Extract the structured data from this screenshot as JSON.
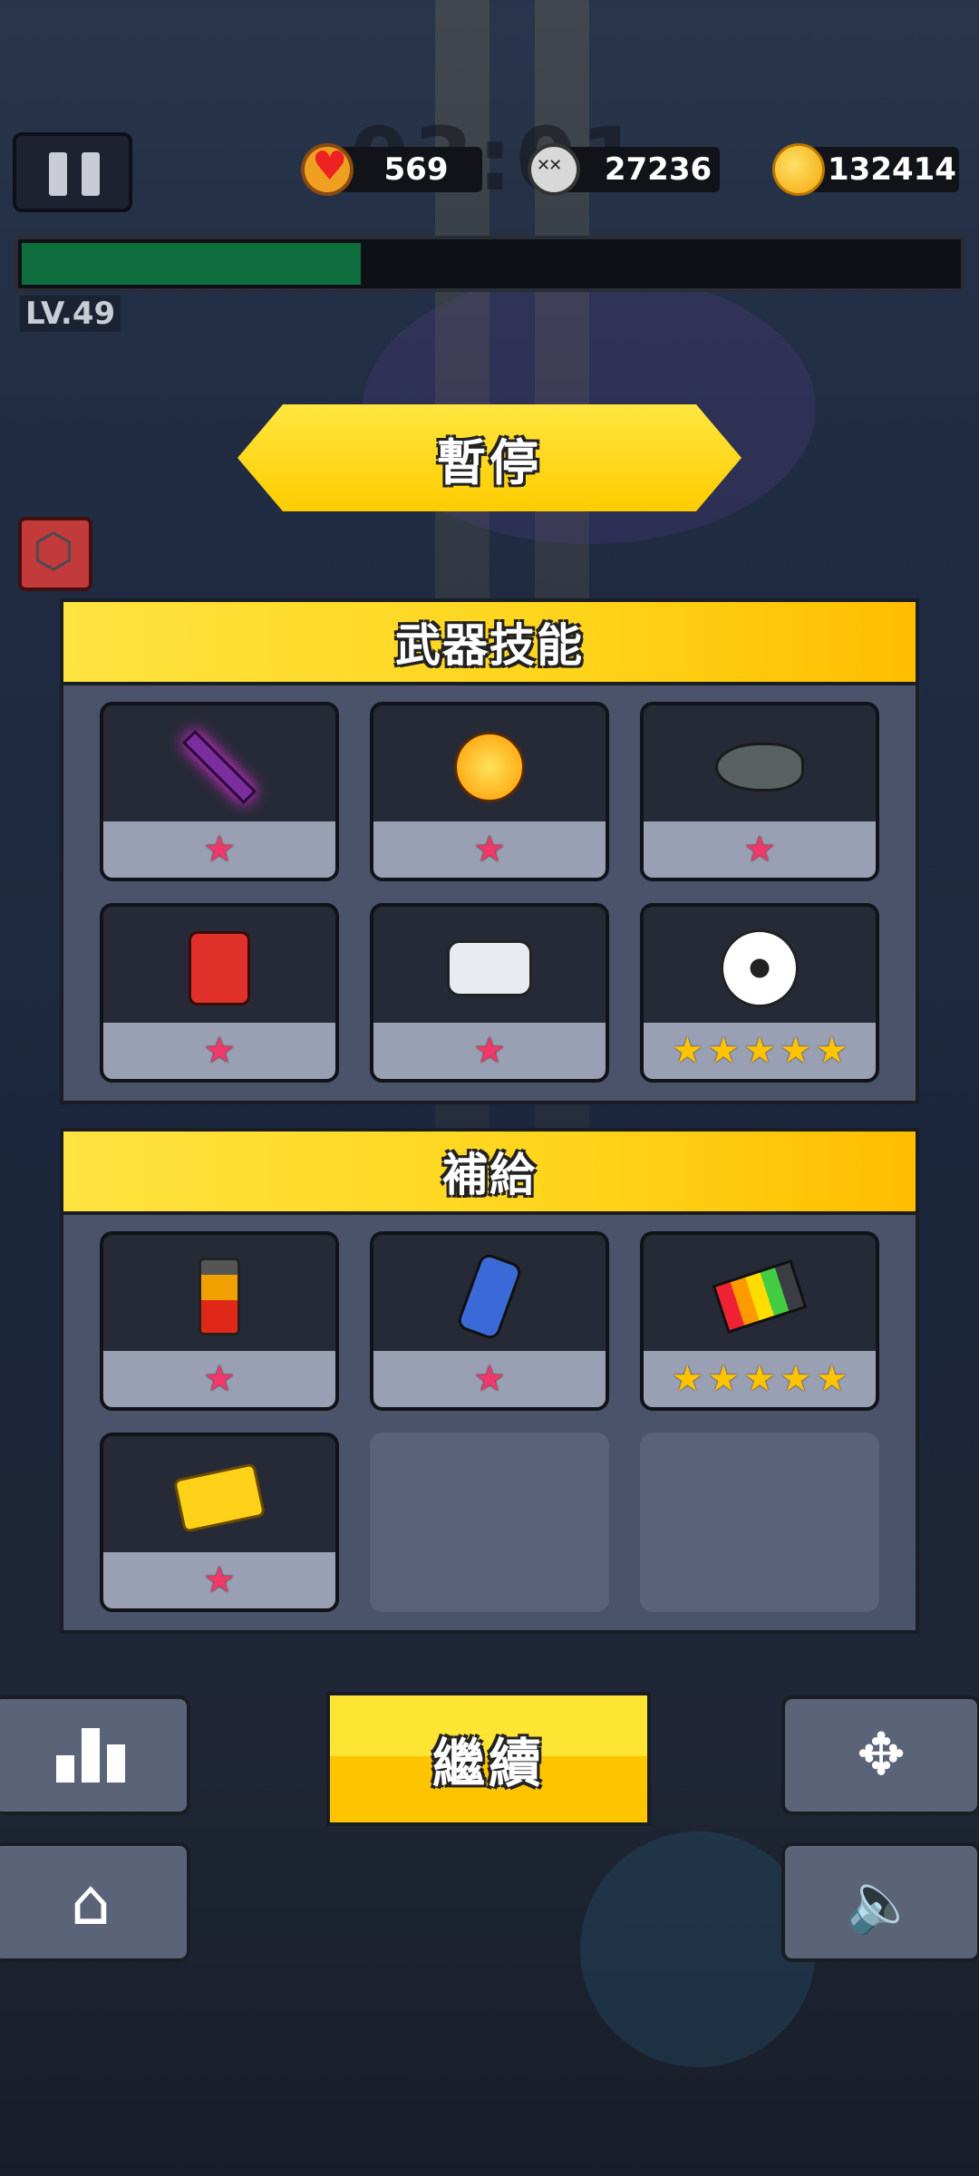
{
  "hud": {
    "hearts": "569",
    "kills": "27236",
    "coins": "132414",
    "level": "LV.49",
    "timer_ghost": "03:01",
    "xp_progress": 0.36
  },
  "pause_title": "暫停",
  "weapons": {
    "title": "武器技能",
    "slots": [
      {
        "icon": "sword-icon",
        "stars": 1,
        "star_color": "pink"
      },
      {
        "icon": "fireball-paw-icon",
        "stars": 1,
        "star_color": "pink"
      },
      {
        "icon": "shark-rocket-icon",
        "stars": 1,
        "star_color": "pink"
      },
      {
        "icon": "fuel-can-icon",
        "stars": 1,
        "star_color": "pink"
      },
      {
        "icon": "drone-icon",
        "stars": 1,
        "star_color": "pink"
      },
      {
        "icon": "soccer-ball-icon",
        "stars": 5,
        "star_color": "gold"
      }
    ]
  },
  "supplies": {
    "title": "補給",
    "slots": [
      {
        "icon": "battery-icon",
        "stars": 1,
        "star_color": "pink"
      },
      {
        "icon": "spray-can-icon",
        "stars": 1,
        "star_color": "pink"
      },
      {
        "icon": "charger-icon",
        "stars": 5,
        "star_color": "gold"
      },
      {
        "icon": "ticket-icon",
        "stars": 1,
        "star_color": "pink"
      }
    ],
    "empty_slots": 2
  },
  "buttons": {
    "continue": "繼續",
    "stats_icon": "bar-chart-icon",
    "home_icon": "home-icon",
    "move_icon": "move-arrows-icon",
    "sound_icon": "speaker-icon"
  },
  "colors": {
    "accent": "#ffd41a",
    "star_pink": "#f0386a",
    "star_gold": "#ffc400",
    "xp_green": "#0f6e3e"
  }
}
